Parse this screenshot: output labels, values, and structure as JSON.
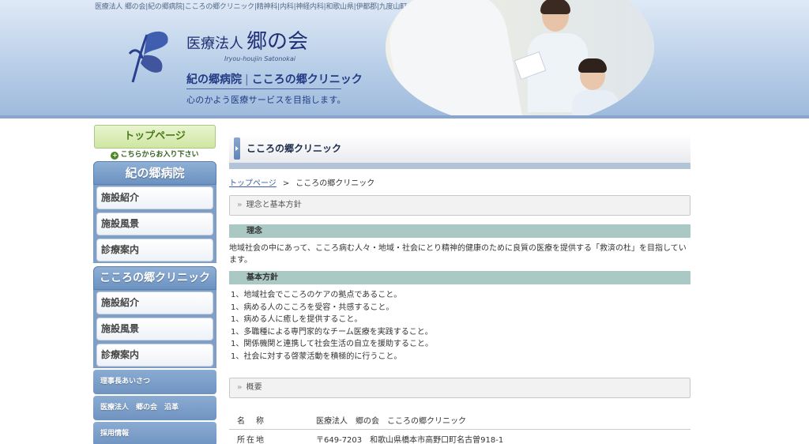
{
  "header": {
    "keywords": "医療法人 郷の会|紀の郷病院|こころの郷クリニック|精神科|内科|神経内科|和歌山県|伊都郡|九度山町",
    "org_prefix": "医療法人",
    "org_name": "郷の会",
    "org_romaji": "Iryou-houjin Satonokai",
    "facility_1": "紀の郷病院",
    "facility_2": "こころの郷クリニック",
    "slogan": "心のかよう医療サービスを目指します。",
    "colors": {
      "header_bg": "#b9cfe8",
      "brand_text": "#1f2f74"
    }
  },
  "sidebar": {
    "top_page": "トップページ",
    "enter_here": "こちらからお入り下さい",
    "enter_icon": "plus-circle-icon",
    "groups": [
      {
        "title": "紀の郷病院",
        "items": [
          "施設紹介",
          "施設風景",
          "診療案内"
        ]
      },
      {
        "title": "こころの郷クリニック",
        "items": [
          "施設紹介",
          "施設風景",
          "診療案内"
        ]
      }
    ],
    "links": [
      "理事長あいさつ",
      "医療法人　郷の会　沿革",
      "採用情報"
    ],
    "colors": {
      "group_head": "#7f9fc7",
      "top_btn": "#cfe6a3"
    }
  },
  "main": {
    "page_title": "こころの郷クリニック",
    "breadcrumb": {
      "home": "トップページ",
      "separator": ">",
      "current": "こころの郷クリニック"
    },
    "section1": {
      "heading": "理念と基本方針",
      "rinen_label": "理念",
      "rinen_text": "地域社会の中にあって、こころ病む人々・地域・社会にとり精神的健康のために良質の医療を提供する「救済の杜」を目指しています。",
      "policy_label": "基本方針",
      "policies": [
        "1、地域社会でこころのケアの拠点であること。",
        "1、病める人のこころを受容・共感すること。",
        "1、病める人に癒しを提供すること。",
        "1、多職種による専門家的なチーム医療を実践すること。",
        "1、関係機関と連携して社会生活の自立を援助すること。",
        "1、社会に対する啓蒙活動を積極的に行うこと。"
      ]
    },
    "section2": {
      "heading": "概要",
      "rows": [
        {
          "key": "名　称",
          "value": "医療法人　郷の会　こころの郷クリニック"
        },
        {
          "key": "所在地",
          "value": "〒649-7203　和歌山県橋本市高野口町名古曽918-1"
        }
      ]
    },
    "colors": {
      "band": "#aac9c4",
      "title_underline": "#b3c4d9",
      "link": "#3a5fa0"
    }
  }
}
